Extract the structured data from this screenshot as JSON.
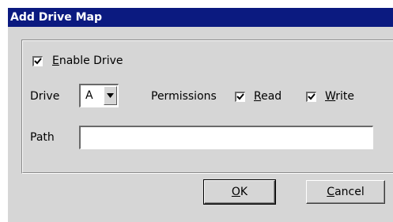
{
  "dialog": {
    "title": "Add Drive Map"
  },
  "enable_drive": {
    "label_first": "E",
    "label_rest": "nable Drive",
    "checked": true
  },
  "drive": {
    "label": "Drive",
    "selected": "A"
  },
  "permissions": {
    "label": "Permissions",
    "read": {
      "label_first": "R",
      "label_rest": "ead",
      "checked": true
    },
    "write": {
      "label_first": "W",
      "label_rest": "rite",
      "checked": true
    }
  },
  "path": {
    "label": "Path",
    "value": ""
  },
  "buttons": {
    "ok_first": "O",
    "ok_rest": "K",
    "cancel_first": "C",
    "cancel_rest": "ancel"
  },
  "colors": {
    "titlebar": "#0b1a80",
    "window_bg": "#d6d6d6"
  }
}
